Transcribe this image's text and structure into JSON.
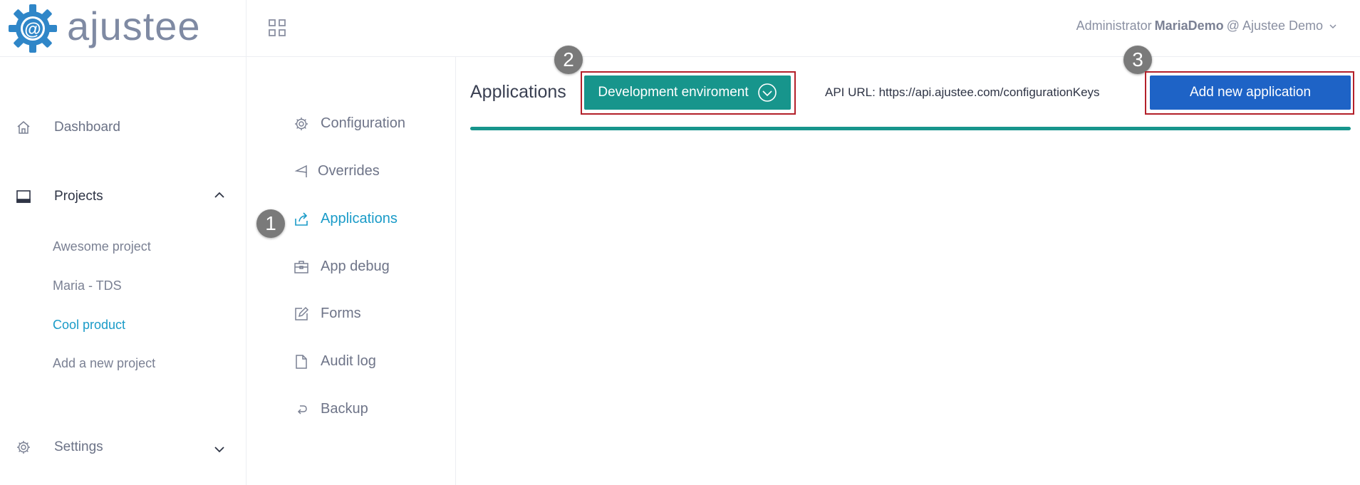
{
  "brand": {
    "name": "ajustee",
    "logo_letter": "@",
    "color": "#2f86c8"
  },
  "header": {
    "apps_icon": "grid-icon",
    "user_role": "Administrator",
    "user_name": "MariaDemo",
    "user_separator": "@",
    "workspace": "Ajustee Demo"
  },
  "sidebar": {
    "dashboard": {
      "label": "Dashboard",
      "icon": "home-icon"
    },
    "projects": {
      "label": "Projects",
      "icon": "monitor-icon",
      "expanded": true,
      "items": [
        {
          "label": "Awesome project",
          "active": false
        },
        {
          "label": "Maria - TDS",
          "active": false
        },
        {
          "label": "Cool product",
          "active": true
        },
        {
          "label": "Add a new project",
          "active": false
        }
      ]
    },
    "settings": {
      "label": "Settings",
      "icon": "gear-icon",
      "expanded": false
    }
  },
  "subnav": {
    "items": [
      {
        "label": "Configuration",
        "icon": "gear-icon",
        "active": false
      },
      {
        "label": "Overrides",
        "icon": "send-icon",
        "active": false
      },
      {
        "label": "Applications",
        "icon": "share-icon",
        "active": true
      },
      {
        "label": "App debug",
        "icon": "briefcase-icon",
        "active": false
      },
      {
        "label": "Forms",
        "icon": "edit-icon",
        "active": false
      },
      {
        "label": "Audit log",
        "icon": "file-icon",
        "active": false
      },
      {
        "label": "Backup",
        "icon": "undo-icon",
        "active": false
      }
    ]
  },
  "main": {
    "title": "Applications",
    "environment_button": "Development enviroment",
    "api_url_label": "API URL:",
    "api_url": "https://api.ajustee.com/configurationKeys",
    "add_button": "Add new application",
    "progress_fraction": 1.0
  },
  "callouts": [
    "1",
    "2",
    "3"
  ],
  "colors": {
    "teal": "#17958c",
    "blue": "#1e63c6",
    "active_link": "#1a9bc8",
    "highlight_frame": "#b3202a",
    "callout_badge": "#7a7a7a"
  }
}
